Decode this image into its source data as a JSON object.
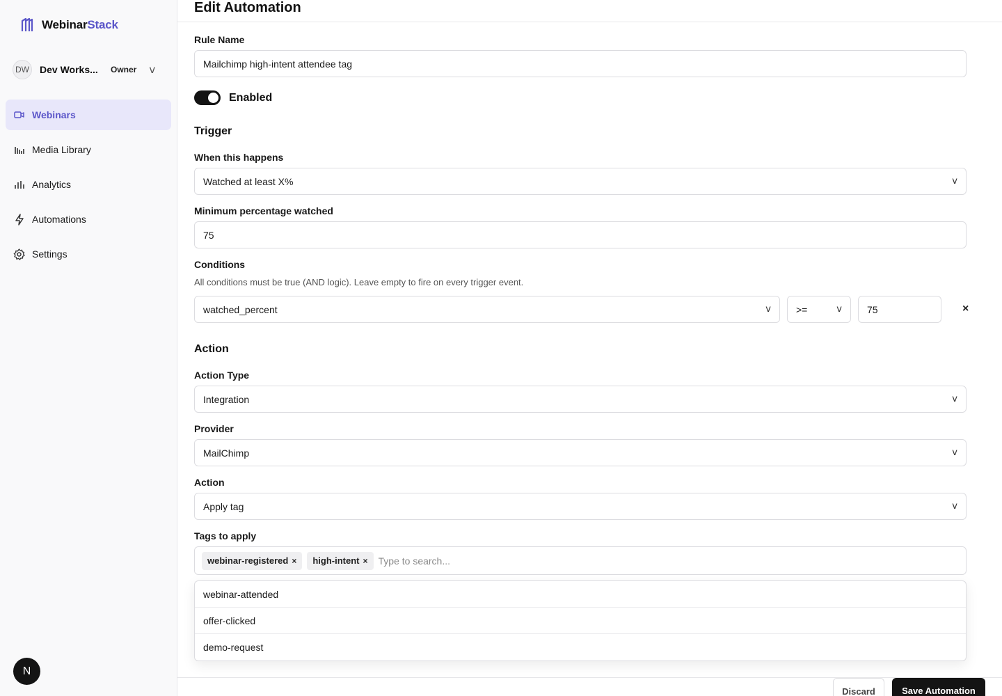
{
  "brand": {
    "name_main": "Webinar",
    "name_accent": "Stack",
    "logo_icon": "columns-logo-icon",
    "accent_color": "#5b56c9"
  },
  "workspace": {
    "initials": "DW",
    "name": "Dev Works...",
    "role": "Owner",
    "chevron": "v"
  },
  "nav": [
    {
      "label": "Webinars",
      "icon": "video-camera-icon",
      "active": true
    },
    {
      "label": "Media Library",
      "icon": "media-library-icon",
      "active": false
    },
    {
      "label": "Analytics",
      "icon": "bar-chart-icon",
      "active": false
    },
    {
      "label": "Automations",
      "icon": "lightning-icon",
      "active": false
    },
    {
      "label": "Settings",
      "icon": "gear-icon",
      "active": false
    }
  ],
  "user": {
    "initial": "N"
  },
  "page": {
    "title": "Edit Automation"
  },
  "form": {
    "rule_name_label": "Rule Name",
    "rule_name_value": "Mailchimp high-intent attendee tag",
    "enabled_label": "Enabled",
    "enabled": true,
    "trigger_section": "Trigger",
    "when_label": "When this happens",
    "when_value": "Watched at least X%",
    "min_pct_label": "Minimum percentage watched",
    "min_pct_value": "75",
    "conditions_label": "Conditions",
    "conditions_helper": "All conditions must be true (AND logic). Leave empty to fire on every trigger event.",
    "condition": {
      "field": "watched_percent",
      "operator": ">=",
      "value": "75",
      "remove": "×"
    },
    "action_section": "Action",
    "action_type_label": "Action Type",
    "action_type_value": "Integration",
    "provider_label": "Provider",
    "provider_value": "MailChimp",
    "action_label": "Action",
    "action_value": "Apply tag",
    "tags_label": "Tags to apply",
    "tags": [
      "webinar-registered",
      "high-intent"
    ],
    "tag_remove": "×",
    "tag_search_placeholder": "Type to search...",
    "tag_options": [
      "webinar-attended",
      "offer-clicked",
      "demo-request"
    ],
    "chevron": "v"
  },
  "footer": {
    "discard_label": "Discard",
    "save_label": "Save Automation"
  }
}
